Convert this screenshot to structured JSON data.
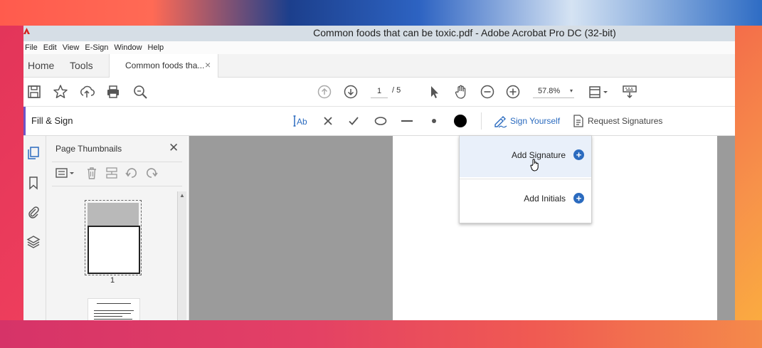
{
  "window": {
    "title": "Common foods that can be toxic.pdf - Adobe Acrobat Pro DC (32-bit)"
  },
  "menu": [
    "File",
    "Edit",
    "View",
    "E-Sign",
    "Window",
    "Help"
  ],
  "tabs": {
    "home": "Home",
    "tools": "Tools",
    "document": "Common foods tha...",
    "close_glyph": "×"
  },
  "toolbar": {
    "current_page": "1",
    "total_pages": "/ 5",
    "zoom": "57.8%",
    "zoom_caret": "▾",
    "icons": [
      "save-icon",
      "star-icon",
      "upload-icon",
      "print-icon",
      "search-zoom-icon",
      "page-up-icon",
      "page-down-icon",
      "select-cursor-icon",
      "hand-icon",
      "zoom-out-icon",
      "zoom-in-icon",
      "fit-page-icon",
      "keyboard-icon"
    ]
  },
  "fill_sign": {
    "title": "Fill & Sign",
    "tools": [
      "text-tool-icon",
      "cross-icon",
      "check-icon",
      "ellipse-icon",
      "line-icon",
      "dot-icon",
      "color-swatch-icon"
    ],
    "sign_yourself": "Sign Yourself",
    "request_signatures": "Request Signatures",
    "accent_color": "#6e54c7",
    "link_color": "#2b6bbf"
  },
  "thumbnails": {
    "header": "Page Thumbnails",
    "close_glyph": "✕",
    "page_label": "1",
    "scroll_up_glyph": "▲"
  },
  "dropdown": {
    "items": [
      {
        "label": "Add Signature",
        "icon": "plus-circle-icon",
        "highlighted": true
      },
      {
        "label": "Add Initials",
        "icon": "plus-circle-icon",
        "highlighted": false
      }
    ]
  }
}
